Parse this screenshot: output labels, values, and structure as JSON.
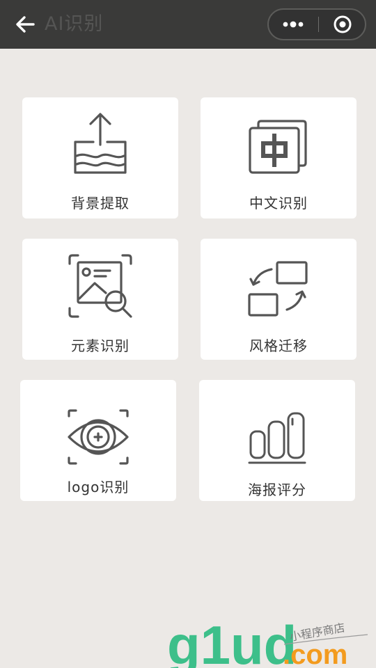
{
  "nav": {
    "title": "AI识别",
    "back_icon": "arrow-left-icon",
    "more_icon": "more-dots-icon",
    "close_icon": "target-circle-icon",
    "bar_color": "#3A3A39"
  },
  "features": [
    {
      "label": "背景提取",
      "icon": "upload-tray-icon"
    },
    {
      "label": "中文识别",
      "icon": "chinese-char-card-icon"
    },
    {
      "label": "元素识别",
      "icon": "image-magnifier-icon"
    },
    {
      "label": "风格迁移",
      "icon": "swap-frames-icon"
    },
    {
      "label": "logo识别",
      "icon": "eye-scan-icon"
    },
    {
      "label": "海报评分",
      "icon": "bar-meter-icon"
    }
  ],
  "watermark": {
    "brand": "g1ud",
    "domain": ".com",
    "tagline": "小程序商店"
  },
  "colors": {
    "background": "#ECE9E6",
    "card": "#FFFFFF",
    "icon_stroke": "#555555",
    "watermark_green": "#3DBF8A",
    "watermark_orange": "#F39B1E"
  }
}
